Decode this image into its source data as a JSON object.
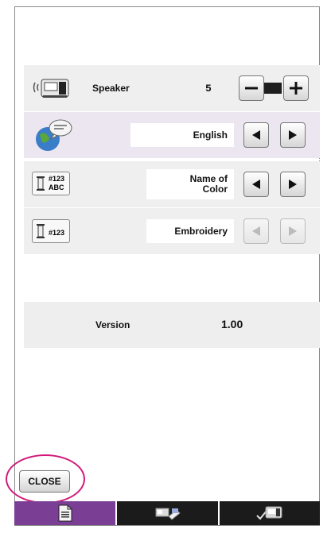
{
  "rows": [
    {
      "label": "Speaker",
      "value": "5",
      "icon": "speaker-machine-icon"
    },
    {
      "value": "English",
      "icon": "globe-speech-icon"
    },
    {
      "value": "Name of Color",
      "icon": "thread-name-icon",
      "icon_text1": "#123",
      "icon_text2": "ABC"
    },
    {
      "value": "Embroidery",
      "icon": "thread-number-icon",
      "icon_text": "#123"
    }
  ],
  "version": {
    "label": "Version",
    "value": "1.00"
  },
  "close_label": "CLOSE",
  "tabs": [
    {
      "name": "page-icon",
      "active": true
    },
    {
      "name": "sewing-embroidery-icon",
      "active": false
    },
    {
      "name": "machine-settings-icon",
      "active": false
    }
  ],
  "colors": {
    "accent": "#7a3f95",
    "highlight": "#d1197a",
    "tab_dark": "#1b1b1b"
  }
}
